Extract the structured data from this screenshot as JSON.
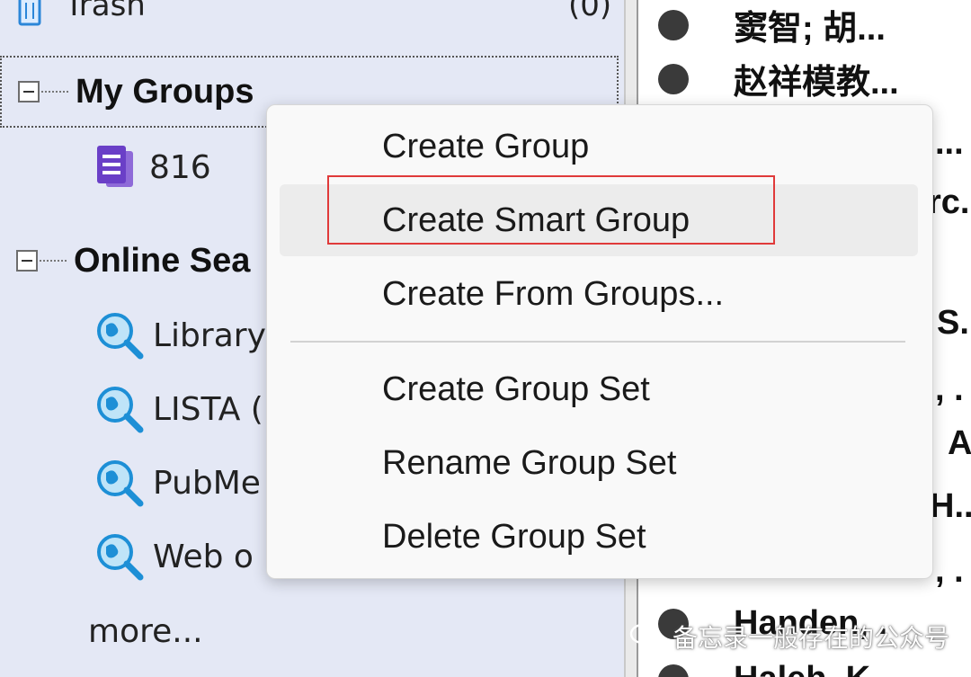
{
  "sidebar": {
    "trash": {
      "label": "Trash",
      "count": "(0)"
    },
    "my_groups": {
      "label": "My Groups"
    },
    "groups": [
      {
        "label": "816"
      }
    ],
    "online_search": {
      "label": "Online Sea"
    },
    "search_items": [
      {
        "label": "Library"
      },
      {
        "label": "LISTA ("
      },
      {
        "label": "PubMe"
      },
      {
        "label": "Web o"
      }
    ],
    "more": "more..."
  },
  "context_menu": {
    "items": [
      {
        "label": "Create Group"
      },
      {
        "label": "Create Smart Group"
      },
      {
        "label": "Create From Groups..."
      },
      {
        "label": "Create Group Set"
      },
      {
        "label": "Rename Group Set"
      },
      {
        "label": "Delete Group Set"
      }
    ]
  },
  "reference_list": {
    "rows": [
      {
        "text": "窦智; 胡..."
      },
      {
        "text": "赵祥模教..."
      },
      {
        "text": "..."
      },
      {
        "text": "rc."
      },
      {
        "text": "S."
      },
      {
        "text": ", ."
      },
      {
        "text": "A"
      },
      {
        "text": "H.."
      },
      {
        "text": ", ."
      },
      {
        "text": "Handen, ."
      },
      {
        "text": "Haleh, K"
      }
    ]
  },
  "watermark": {
    "text": "备忘录一般存在的公众号"
  },
  "colors": {
    "sidebar_bg": "#e4e8f5",
    "highlight_border": "#e03a3a",
    "group_icon": "#6a3fc7",
    "search_icon": "#1d8fd6"
  },
  "icons": [
    "trash-icon",
    "expander-icon",
    "group-list-icon",
    "online-search-icon",
    "bullet-icon",
    "wechat-icon"
  ]
}
